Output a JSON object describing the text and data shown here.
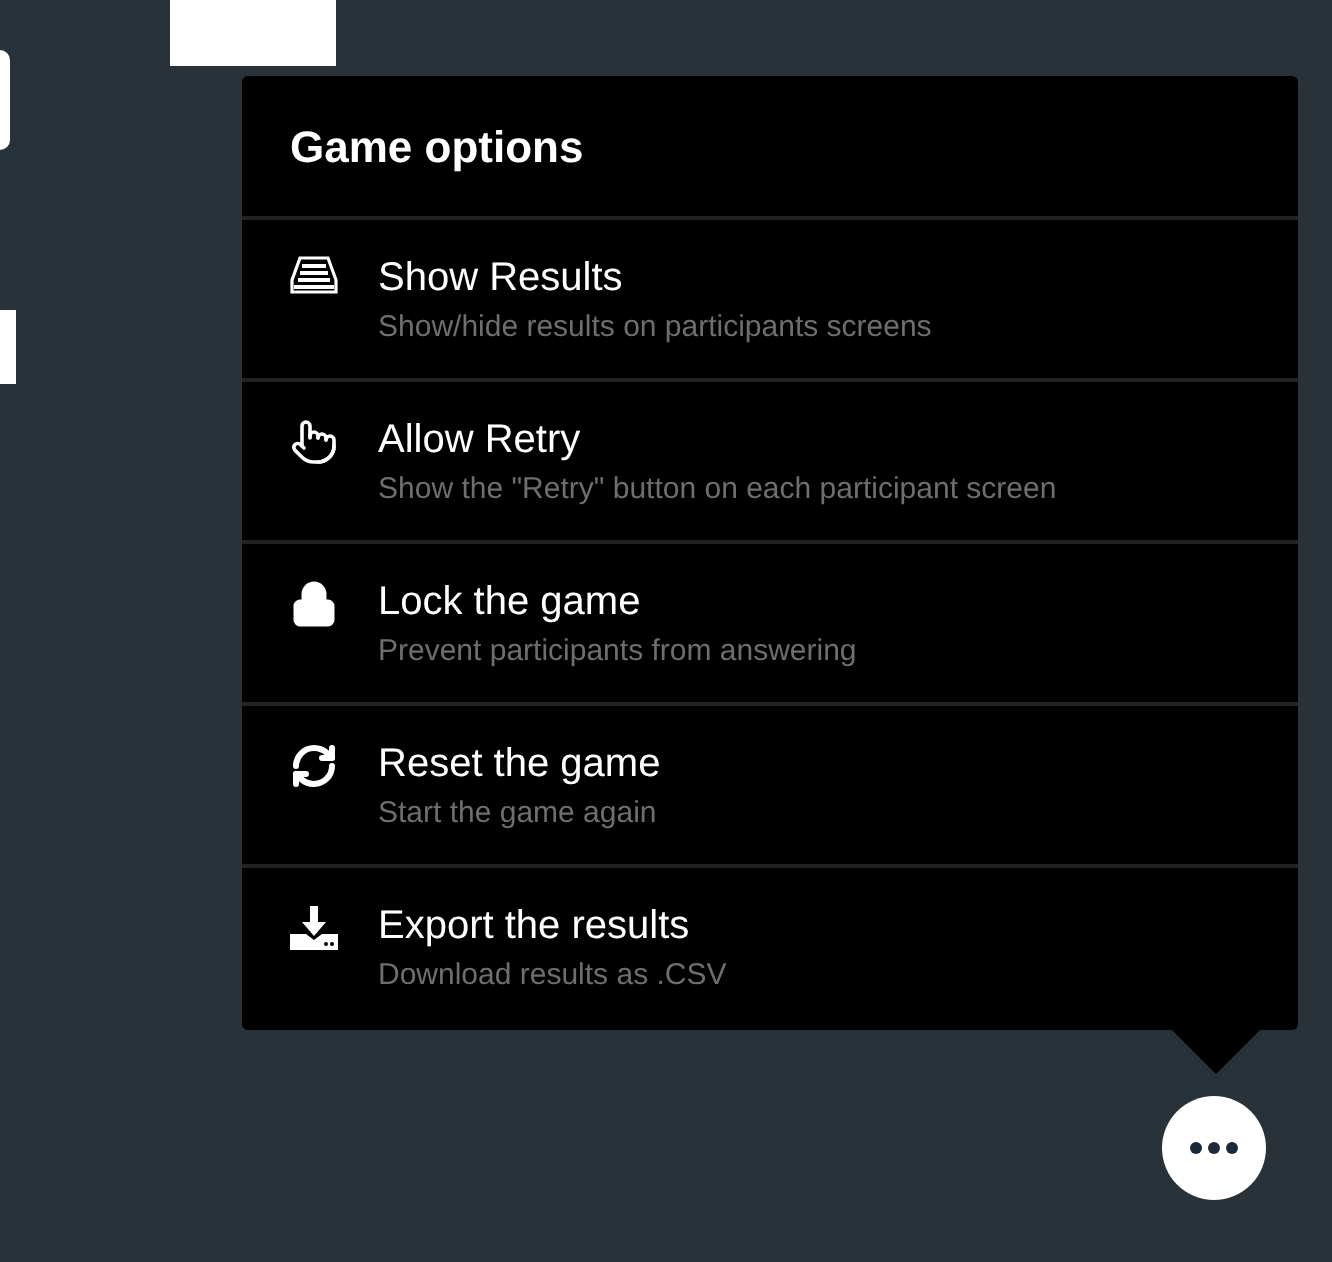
{
  "menu": {
    "title": "Game options",
    "items": [
      {
        "kind": "results",
        "label": "Show Results",
        "description": "Show/hide results on participants screens"
      },
      {
        "kind": "retry",
        "label": "Allow Retry",
        "description": "Show the \"Retry\" button on each participant screen"
      },
      {
        "kind": "lock",
        "label": "Lock the game",
        "description": "Prevent participants from answering"
      },
      {
        "kind": "reset",
        "label": "Reset the game",
        "description": "Start the game again"
      },
      {
        "kind": "export",
        "label": "Export the results",
        "description": "Download results as .CSV"
      }
    ]
  }
}
